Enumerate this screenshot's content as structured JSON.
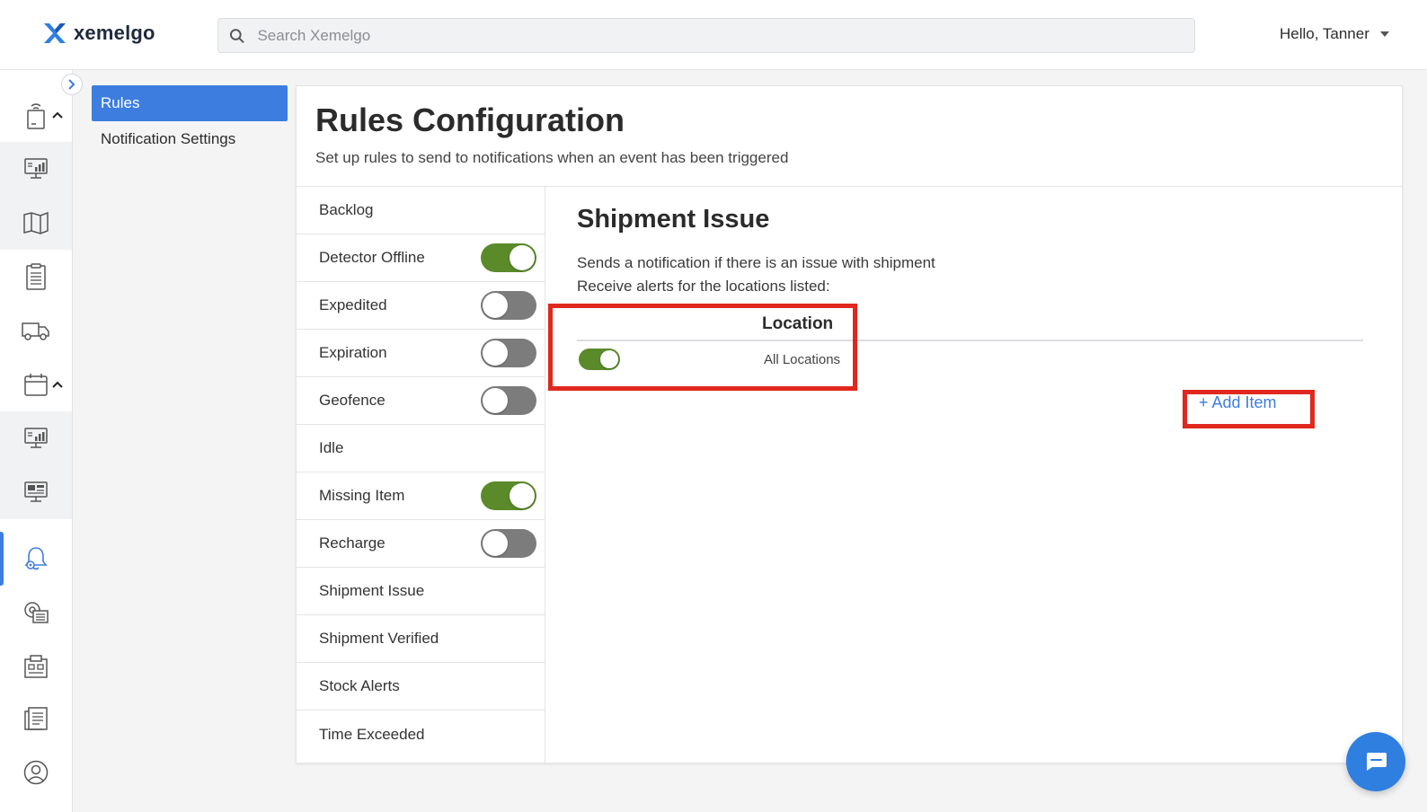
{
  "header": {
    "brand": "xemelgo",
    "search_placeholder": "Search Xemelgo",
    "greeting": "Hello, Tanner"
  },
  "subnav": {
    "items": [
      {
        "label": "Rules",
        "selected": true
      },
      {
        "label": "Notification Settings",
        "selected": false
      }
    ]
  },
  "page": {
    "title": "Rules Configuration",
    "subtitle": "Set up rules to send to notifications when an event has been triggered"
  },
  "rules": [
    {
      "label": "Backlog",
      "toggle": null
    },
    {
      "label": "Detector Offline",
      "toggle": true
    },
    {
      "label": "Expedited",
      "toggle": false
    },
    {
      "label": "Expiration",
      "toggle": false
    },
    {
      "label": "Geofence",
      "toggle": false
    },
    {
      "label": "Idle",
      "toggle": null
    },
    {
      "label": "Missing Item",
      "toggle": true
    },
    {
      "label": "Recharge",
      "toggle": false
    },
    {
      "label": "Shipment Issue",
      "toggle": null
    },
    {
      "label": "Shipment Verified",
      "toggle": null
    },
    {
      "label": "Stock Alerts",
      "toggle": null
    },
    {
      "label": "Time Exceeded",
      "toggle": null
    }
  ],
  "detail": {
    "title": "Shipment Issue",
    "description": "Sends a notification if there is an issue with shipment",
    "locations_prompt": "Receive alerts for the locations listed:",
    "location_header": "Location",
    "location_row": {
      "name": "All Locations",
      "enabled": true
    },
    "add_item_label": "+ Add Item"
  },
  "colors": {
    "accent_blue": "#3d7de0",
    "toggle_on": "#5a8a2a",
    "toggle_off": "#7c7c7c",
    "highlight_red": "#e0281e"
  },
  "rail_icons": [
    "device-icon",
    "dashboard-icon",
    "map-icon",
    "checklist-icon",
    "truck-icon",
    "calendar-icon",
    "monitor-chart-icon",
    "monitor-dashboard-icon",
    "notification-bell-icon",
    "settings-list-icon",
    "building-icon",
    "report-icon",
    "user-profile-icon"
  ]
}
